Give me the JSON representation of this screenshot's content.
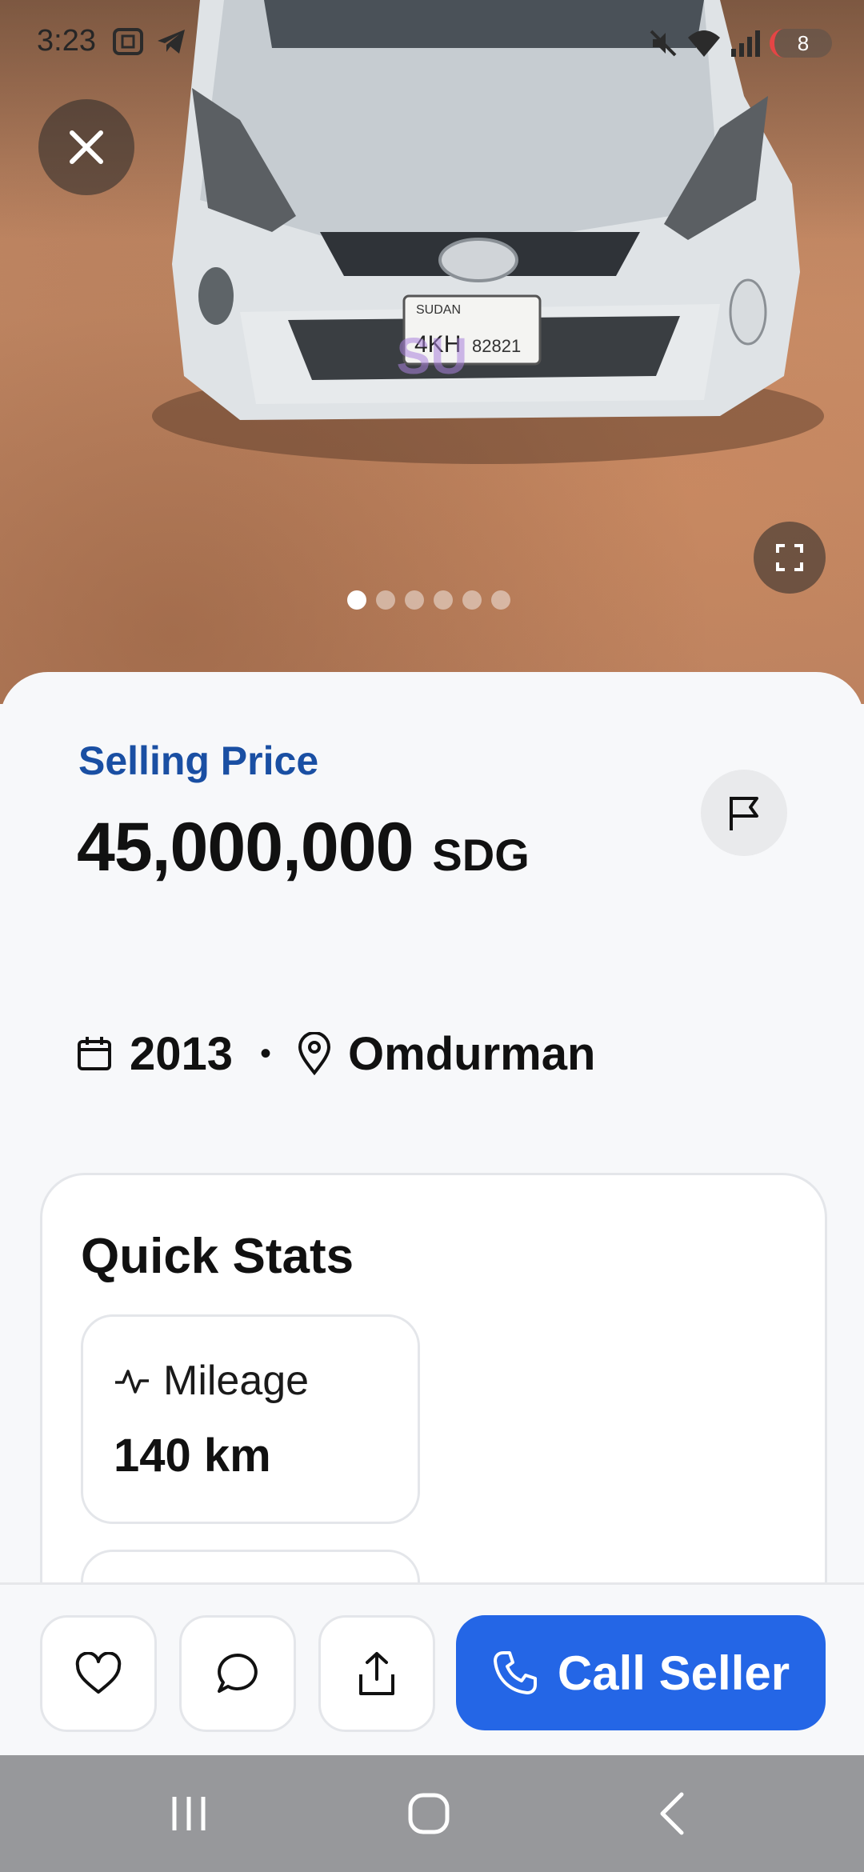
{
  "status_bar": {
    "time": "3:23",
    "battery_level": "8",
    "icons": [
      "screenshot-icon",
      "telegram-icon",
      "mute-icon",
      "wifi-icon",
      "signal-icon",
      "battery-icon"
    ]
  },
  "gallery": {
    "image_count": 6,
    "active_index": 0,
    "watermark": "SU\nسودامارك",
    "plate": "SUDAN السودان 4KH 82821"
  },
  "listing": {
    "price_label": "Selling Price",
    "price_value": "45,000,000",
    "currency": "SDG",
    "year": "2013",
    "separator": "•",
    "location": "Omdurman"
  },
  "quick_stats": {
    "title": "Quick Stats",
    "items": [
      {
        "label": "Mileage",
        "value": "140 km",
        "icon": "activity-icon"
      }
    ]
  },
  "actions": {
    "call_label": "Call Seller"
  },
  "colors": {
    "accent": "#2466e6",
    "price_label": "#1a4fa3",
    "nav_bar": "#97989b"
  }
}
